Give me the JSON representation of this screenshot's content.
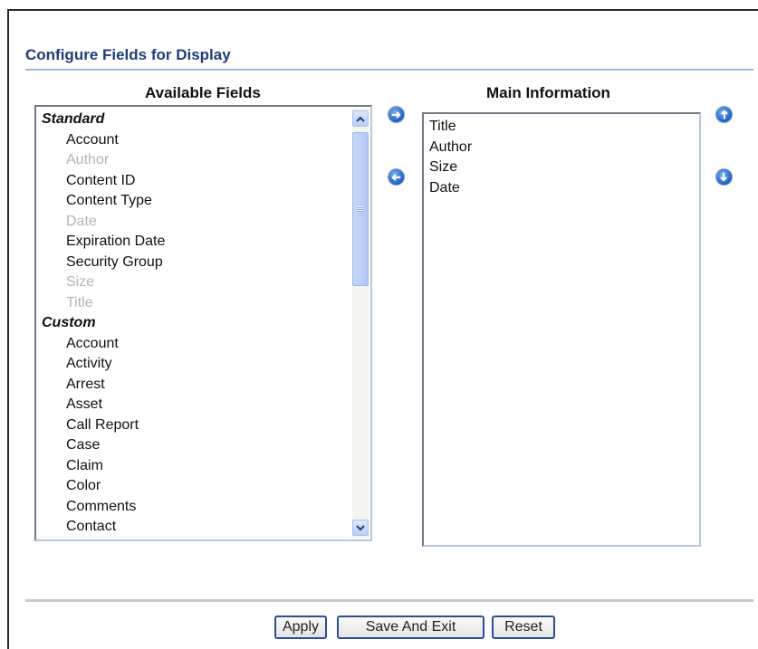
{
  "page": {
    "title": "Configure Fields for Display"
  },
  "available": {
    "heading": "Available Fields",
    "groups": [
      {
        "label": "Standard",
        "items": [
          {
            "label": "Account",
            "disabled": false
          },
          {
            "label": "Author",
            "disabled": true
          },
          {
            "label": "Content ID",
            "disabled": false
          },
          {
            "label": "Content Type",
            "disabled": false
          },
          {
            "label": "Date",
            "disabled": true
          },
          {
            "label": "Expiration Date",
            "disabled": false
          },
          {
            "label": "Security Group",
            "disabled": false
          },
          {
            "label": "Size",
            "disabled": true
          },
          {
            "label": "Title",
            "disabled": true
          }
        ]
      },
      {
        "label": "Custom",
        "items": [
          {
            "label": "Account",
            "disabled": false
          },
          {
            "label": "Activity",
            "disabled": false
          },
          {
            "label": "Arrest",
            "disabled": false
          },
          {
            "label": "Asset",
            "disabled": false
          },
          {
            "label": "Call Report",
            "disabled": false
          },
          {
            "label": "Case",
            "disabled": false
          },
          {
            "label": "Claim",
            "disabled": false
          },
          {
            "label": "Color",
            "disabled": false
          },
          {
            "label": "Comments",
            "disabled": false
          },
          {
            "label": "Contact",
            "disabled": false
          }
        ]
      }
    ]
  },
  "main": {
    "heading": "Main Information",
    "items": [
      "Title",
      "Author",
      "Size",
      "Date"
    ]
  },
  "icons": {
    "move_right": "arrow-right-icon",
    "move_left": "arrow-left-icon",
    "move_up": "arrow-up-icon",
    "move_down": "arrow-down-icon"
  },
  "buttons": {
    "apply": "Apply",
    "save_and_exit": "Save And Exit",
    "reset": "Reset"
  },
  "colors": {
    "title": "#1f3d7a",
    "accent": "#1b5fc4",
    "disabled_text": "#b4b4b4"
  }
}
